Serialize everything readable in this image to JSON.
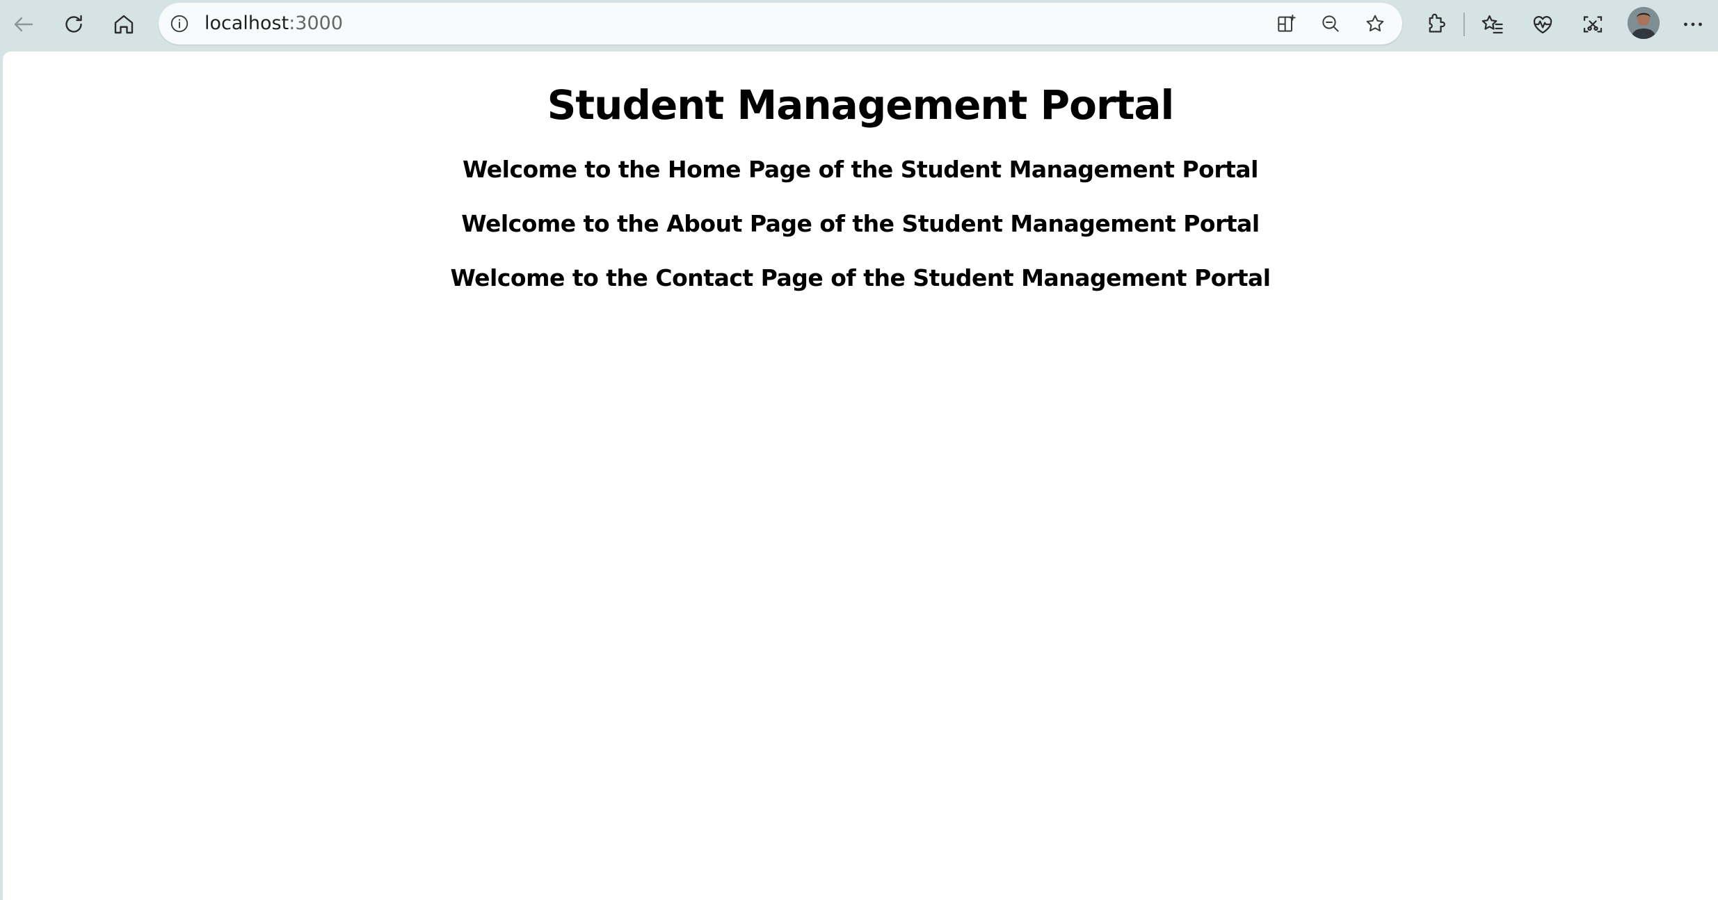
{
  "browser": {
    "address_bar": {
      "host": "localhost",
      "port": ":3000"
    },
    "icons": {
      "back": "back-arrow-icon",
      "reload": "reload-icon",
      "home": "home-icon",
      "site_info": "info-icon",
      "split_screen": "split-screen-icon",
      "zoom_out": "zoom-out-icon",
      "favorite": "star-icon",
      "extensions": "puzzle-icon",
      "favorites": "favorites-list-icon",
      "browser_essentials": "heartbeat-icon",
      "screenshot": "screenshot-icon",
      "profile": "avatar",
      "menu": "more-icon"
    }
  },
  "page": {
    "title": "Student Management Portal",
    "sections": {
      "home": "Welcome to the Home Page of the Student Management Portal",
      "about": "Welcome to the About Page of the Student Management Portal",
      "contact": "Welcome to the Contact Page of the Student Management Portal"
    }
  },
  "colors": {
    "chrome_background": "#d5e3e4",
    "omnibox_background": "#f7fbfb",
    "page_background": "#ffffff",
    "text": "#000000"
  }
}
